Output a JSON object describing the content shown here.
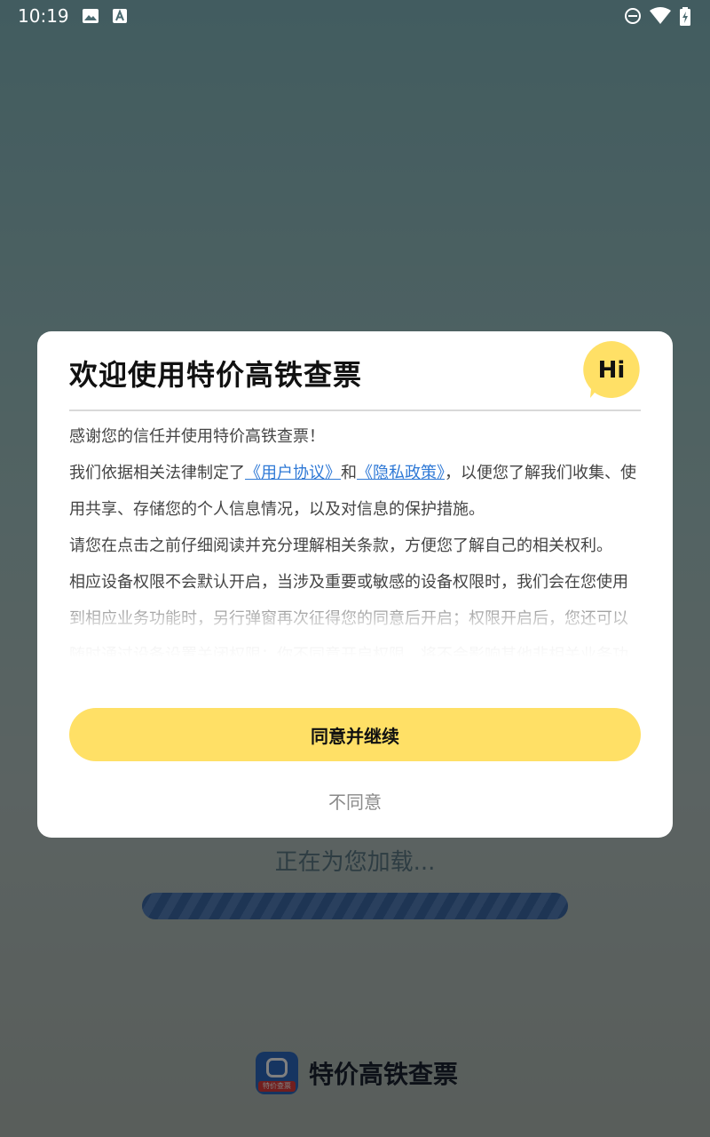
{
  "status_bar": {
    "time": "10:19",
    "left_icons": [
      "image-icon",
      "font-a-icon"
    ],
    "right_icons": [
      "do-not-disturb-icon",
      "wifi-icon",
      "battery-icon"
    ]
  },
  "splash": {
    "loading_text": "正在为您加载...",
    "progress_percent": 100,
    "app_name": "特价高铁查票",
    "logo_tag": "特价查票"
  },
  "dialog": {
    "title": "欢迎使用特价高铁查票",
    "badge": "Hi",
    "paragraphs": {
      "p1": "感谢您的信任并使用特价高铁查票！",
      "p2_before": "我们依据相关法律制定了",
      "link_user_agreement": "《用户协议》",
      "p2_and": "和",
      "link_privacy_policy": "《隐私政策》",
      "p2_after": "，以便您了解我们收集、使用共享、存储您的个人信息情况，以及对信息的保护措施。",
      "p3": "请您在点击之前仔细阅读并充分理解相关条款，方便您了解自己的相关权利。",
      "p4": "相应设备权限不会默认开启，当涉及重要或敏感的设备权限时，我们会在您使用到相应业务功能时，另行弹窗再次征得您的同意后开启；权限开启后，您还可以随时通过设备设置关闭权限；你不同意开启权限，将不会影响其他非相关业务功"
    },
    "agree_button": "同意并继续",
    "disagree_button": "不同意"
  },
  "colors": {
    "accent_yellow": "#ffe066",
    "link_blue": "#2f79d6",
    "progress_blue": "#3d6aa8"
  }
}
